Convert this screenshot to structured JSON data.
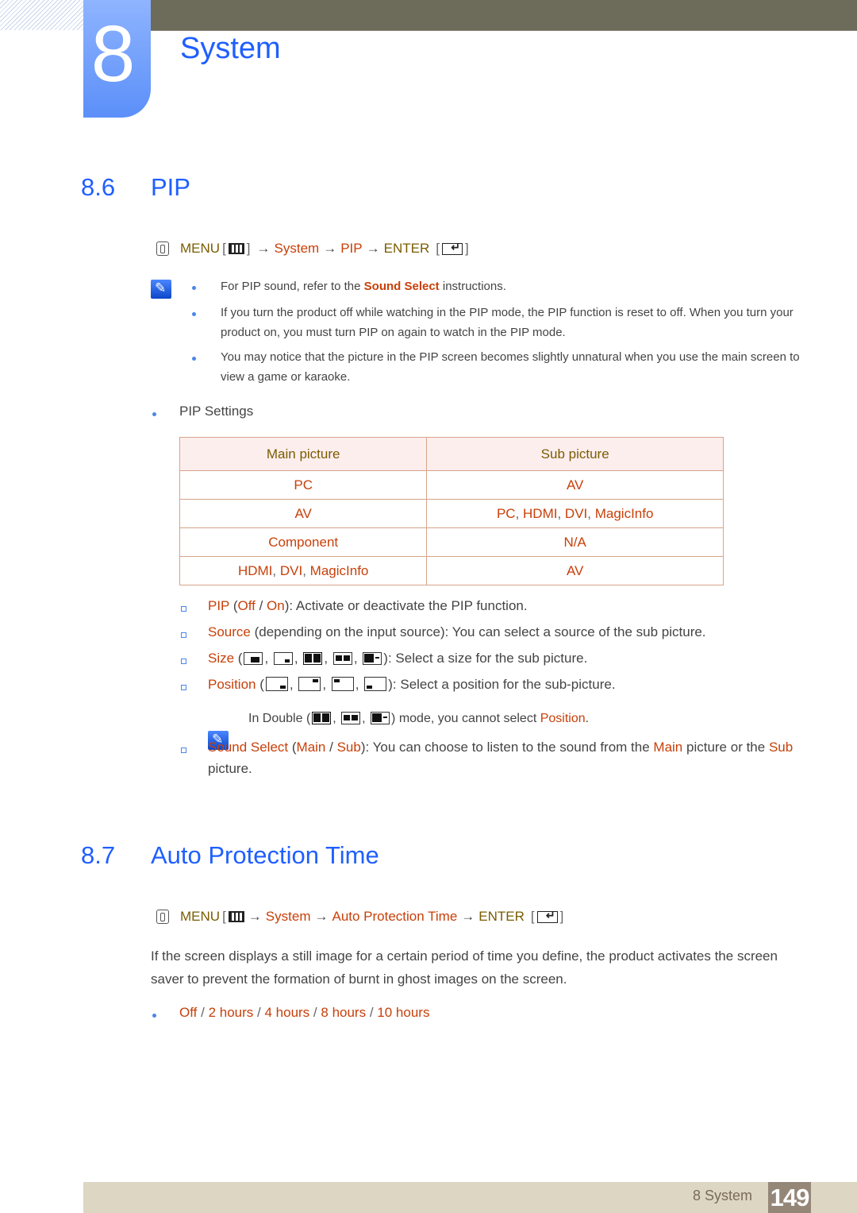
{
  "header": {
    "chapter_number": "8",
    "chapter_title": "System"
  },
  "section_86": {
    "number": "8.6",
    "title": "PIP",
    "menu_path": {
      "menu_label": "MENU",
      "steps": [
        "System",
        "PIP"
      ],
      "enter_label": "ENTER"
    },
    "notes": [
      {
        "before": "For PIP sound, refer to the ",
        "highlight": "Sound Select",
        "after": " instructions."
      },
      {
        "text": "If you turn the product off while watching in the PIP mode, the PIP function is reset to off. When you turn your product on, you must turn PIP on again to watch in the PIP mode."
      },
      {
        "text": "You may notice that the picture in the PIP screen becomes slightly unnatural when you use the main screen to view a game or karaoke."
      }
    ],
    "settings_label": "PIP Settings",
    "table": {
      "headers": [
        "Main picture",
        "Sub picture"
      ],
      "rows": [
        {
          "main": [
            "PC"
          ],
          "sub": [
            "AV"
          ]
        },
        {
          "main": [
            "AV"
          ],
          "sub": [
            "PC",
            "HDMI",
            "DVI",
            "MagicInfo"
          ]
        },
        {
          "main": [
            "Component"
          ],
          "sub": [
            "N/A"
          ]
        },
        {
          "main": [
            "HDMI",
            "DVI",
            "MagicInfo"
          ],
          "sub": [
            "AV"
          ]
        }
      ]
    },
    "options": {
      "pip": {
        "name": "PIP",
        "values": [
          "Off",
          "On"
        ],
        "desc": ": Activate or deactivate the PIP function."
      },
      "source": {
        "name": "Source",
        "desc": " (depending on the input source): You can select a source of the sub picture."
      },
      "size": {
        "name": "Size",
        "icons": [
          "size-large-pip-icon",
          "size-small-pip-icon",
          "size-double-split-icon",
          "size-double-boxed-icon",
          "size-double-large-small-icon"
        ],
        "desc": ": Select a size for the sub picture."
      },
      "position": {
        "name": "Position",
        "icons": [
          "position-bottom-right-icon",
          "position-top-right-icon",
          "position-top-left-icon",
          "position-bottom-left-icon"
        ],
        "desc": ": Select a position for the sub-picture."
      },
      "double_note": {
        "before": "In Double (",
        "after": ") mode, you cannot select ",
        "highlight": "Position",
        "end": "."
      },
      "sound_select": {
        "name": "Sound Select",
        "values": [
          "Main",
          "Sub"
        ],
        "desc1": ": You can choose to listen to the sound from the ",
        "main": "Main",
        "desc2": " picture or the ",
        "sub": "Sub",
        "desc3": " picture."
      }
    }
  },
  "section_87": {
    "number": "8.7",
    "title": "Auto Protection Time",
    "menu_path": {
      "menu_label": "MENU",
      "steps": [
        "System",
        "Auto Protection Time"
      ],
      "enter_label": "ENTER"
    },
    "description": "If the screen displays a still image for a certain period of time you define, the product activates the screen saver to prevent the formation of burnt in ghost images on the screen.",
    "options": [
      "Off",
      "2 hours",
      "4 hours",
      "8 hours",
      "10 hours"
    ]
  },
  "footer": {
    "chapter_label": "8 System",
    "page_number": "149"
  }
}
